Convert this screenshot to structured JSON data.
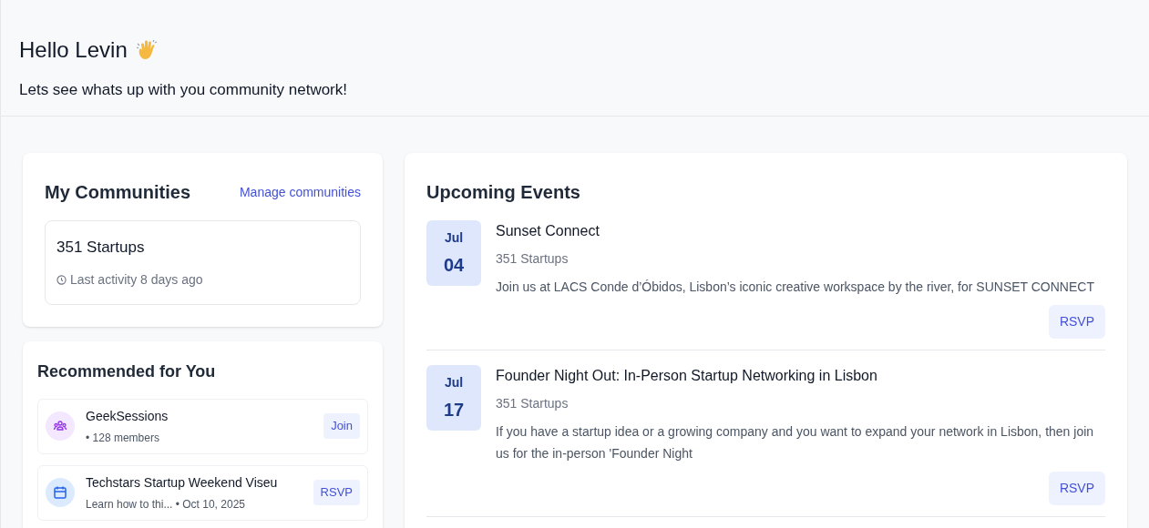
{
  "header": {
    "greeting": "Hello Levin",
    "subtitle": "Lets see whats up with you community network!"
  },
  "my_communities": {
    "title": "My Communities",
    "link": "Manage communities",
    "items": [
      {
        "name": "351 Startups",
        "activity": "Last activity 8 days ago"
      }
    ]
  },
  "recommended": {
    "title": "Recommended for You",
    "items": [
      {
        "kind": "community",
        "name": "GeekSessions",
        "meta": "• 128 members",
        "action": "Join"
      },
      {
        "kind": "event",
        "name": "Techstars Startup Weekend Viseu",
        "meta": "Learn how to thi... • Oct 10, 2025",
        "action": "RSVP"
      }
    ]
  },
  "upcoming_events": {
    "title": "Upcoming Events",
    "items": [
      {
        "month": "Jul",
        "day": "04",
        "title": "Sunset Connect",
        "community": "351 Startups",
        "description": "Join us at LACS Conde d’Óbidos, Lisbon’s iconic creative workspace by the river, for SUNSET CONNECT",
        "action": "RSVP"
      },
      {
        "month": "Jul",
        "day": "17",
        "title": "Founder Night Out: In-Person Startup Networking in Lisbon",
        "community": "351 Startups",
        "description": "If you have a startup idea or a growing company and you want to expand your network in Lisbon, then join us for the in-person 'Founder Night",
        "action": "RSVP"
      }
    ]
  }
}
